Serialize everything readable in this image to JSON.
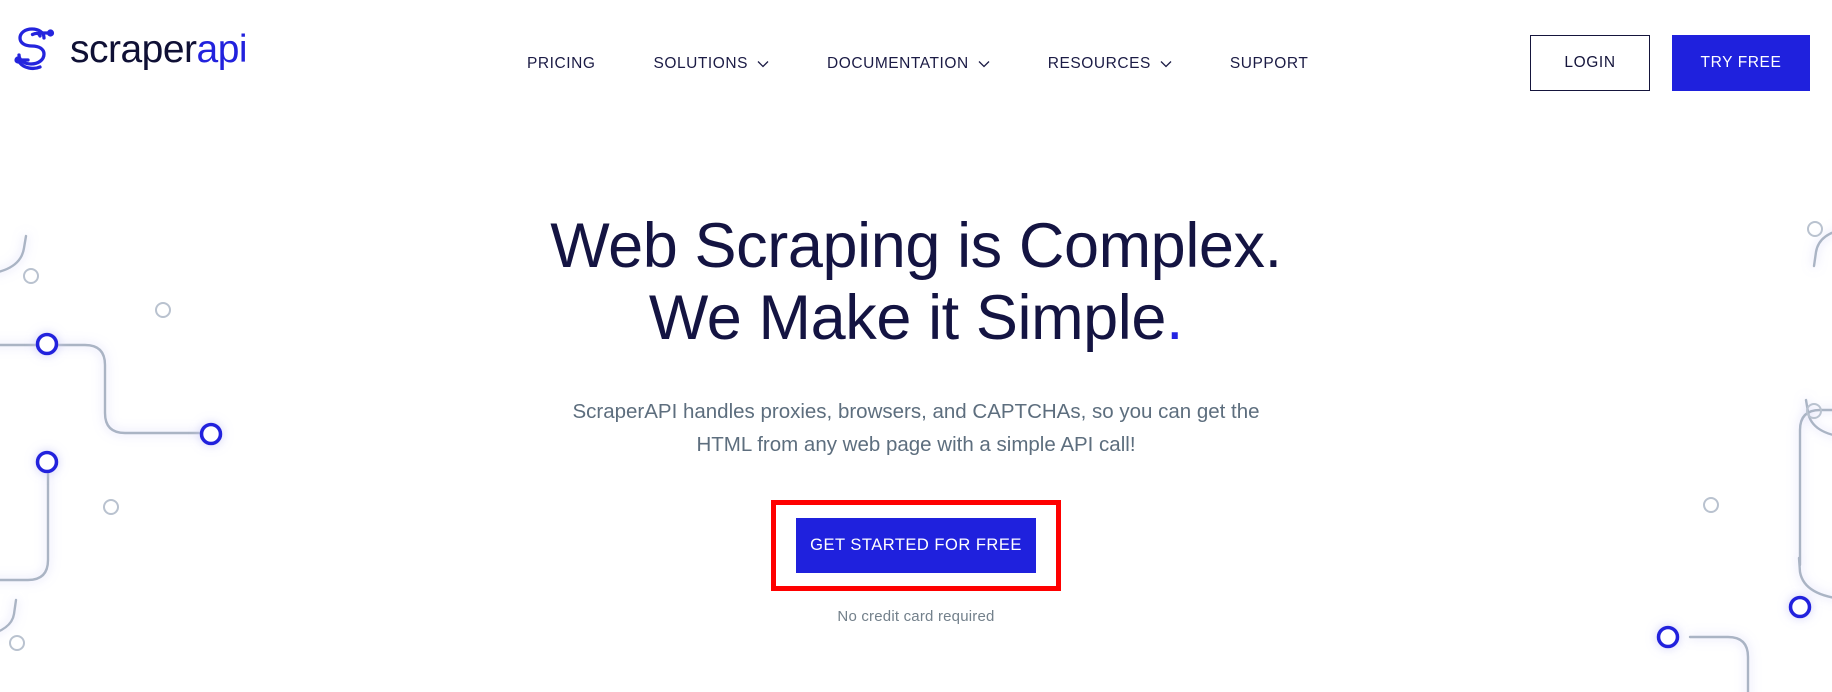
{
  "brand": {
    "logo_icon": "scraperapi-s-circuit-logo",
    "name_part1": "scraper",
    "name_part2": "api",
    "primary_color": "#1f21dd",
    "dark_color": "#141442",
    "annotation_color": "#fe0000"
  },
  "nav": {
    "items": [
      {
        "label": "PRICING",
        "has_dropdown": false
      },
      {
        "label": "SOLUTIONS",
        "has_dropdown": true
      },
      {
        "label": "DOCUMENTATION",
        "has_dropdown": true
      },
      {
        "label": "RESOURCES",
        "has_dropdown": true
      },
      {
        "label": "SUPPORT",
        "has_dropdown": false
      }
    ]
  },
  "header_actions": {
    "login_label": "LOGIN",
    "try_free_label": "TRY FREE"
  },
  "hero": {
    "headline_line1": "Web Scraping is Complex.",
    "headline_line2": "We Make it Simple",
    "headline_period": ".",
    "subtitle": "ScraperAPI handles proxies, browsers, and CAPTCHAs, so you can get the HTML from any web page with a simple API call!",
    "cta_label": "GET STARTED FOR FREE",
    "cta_note": "No credit card required"
  }
}
